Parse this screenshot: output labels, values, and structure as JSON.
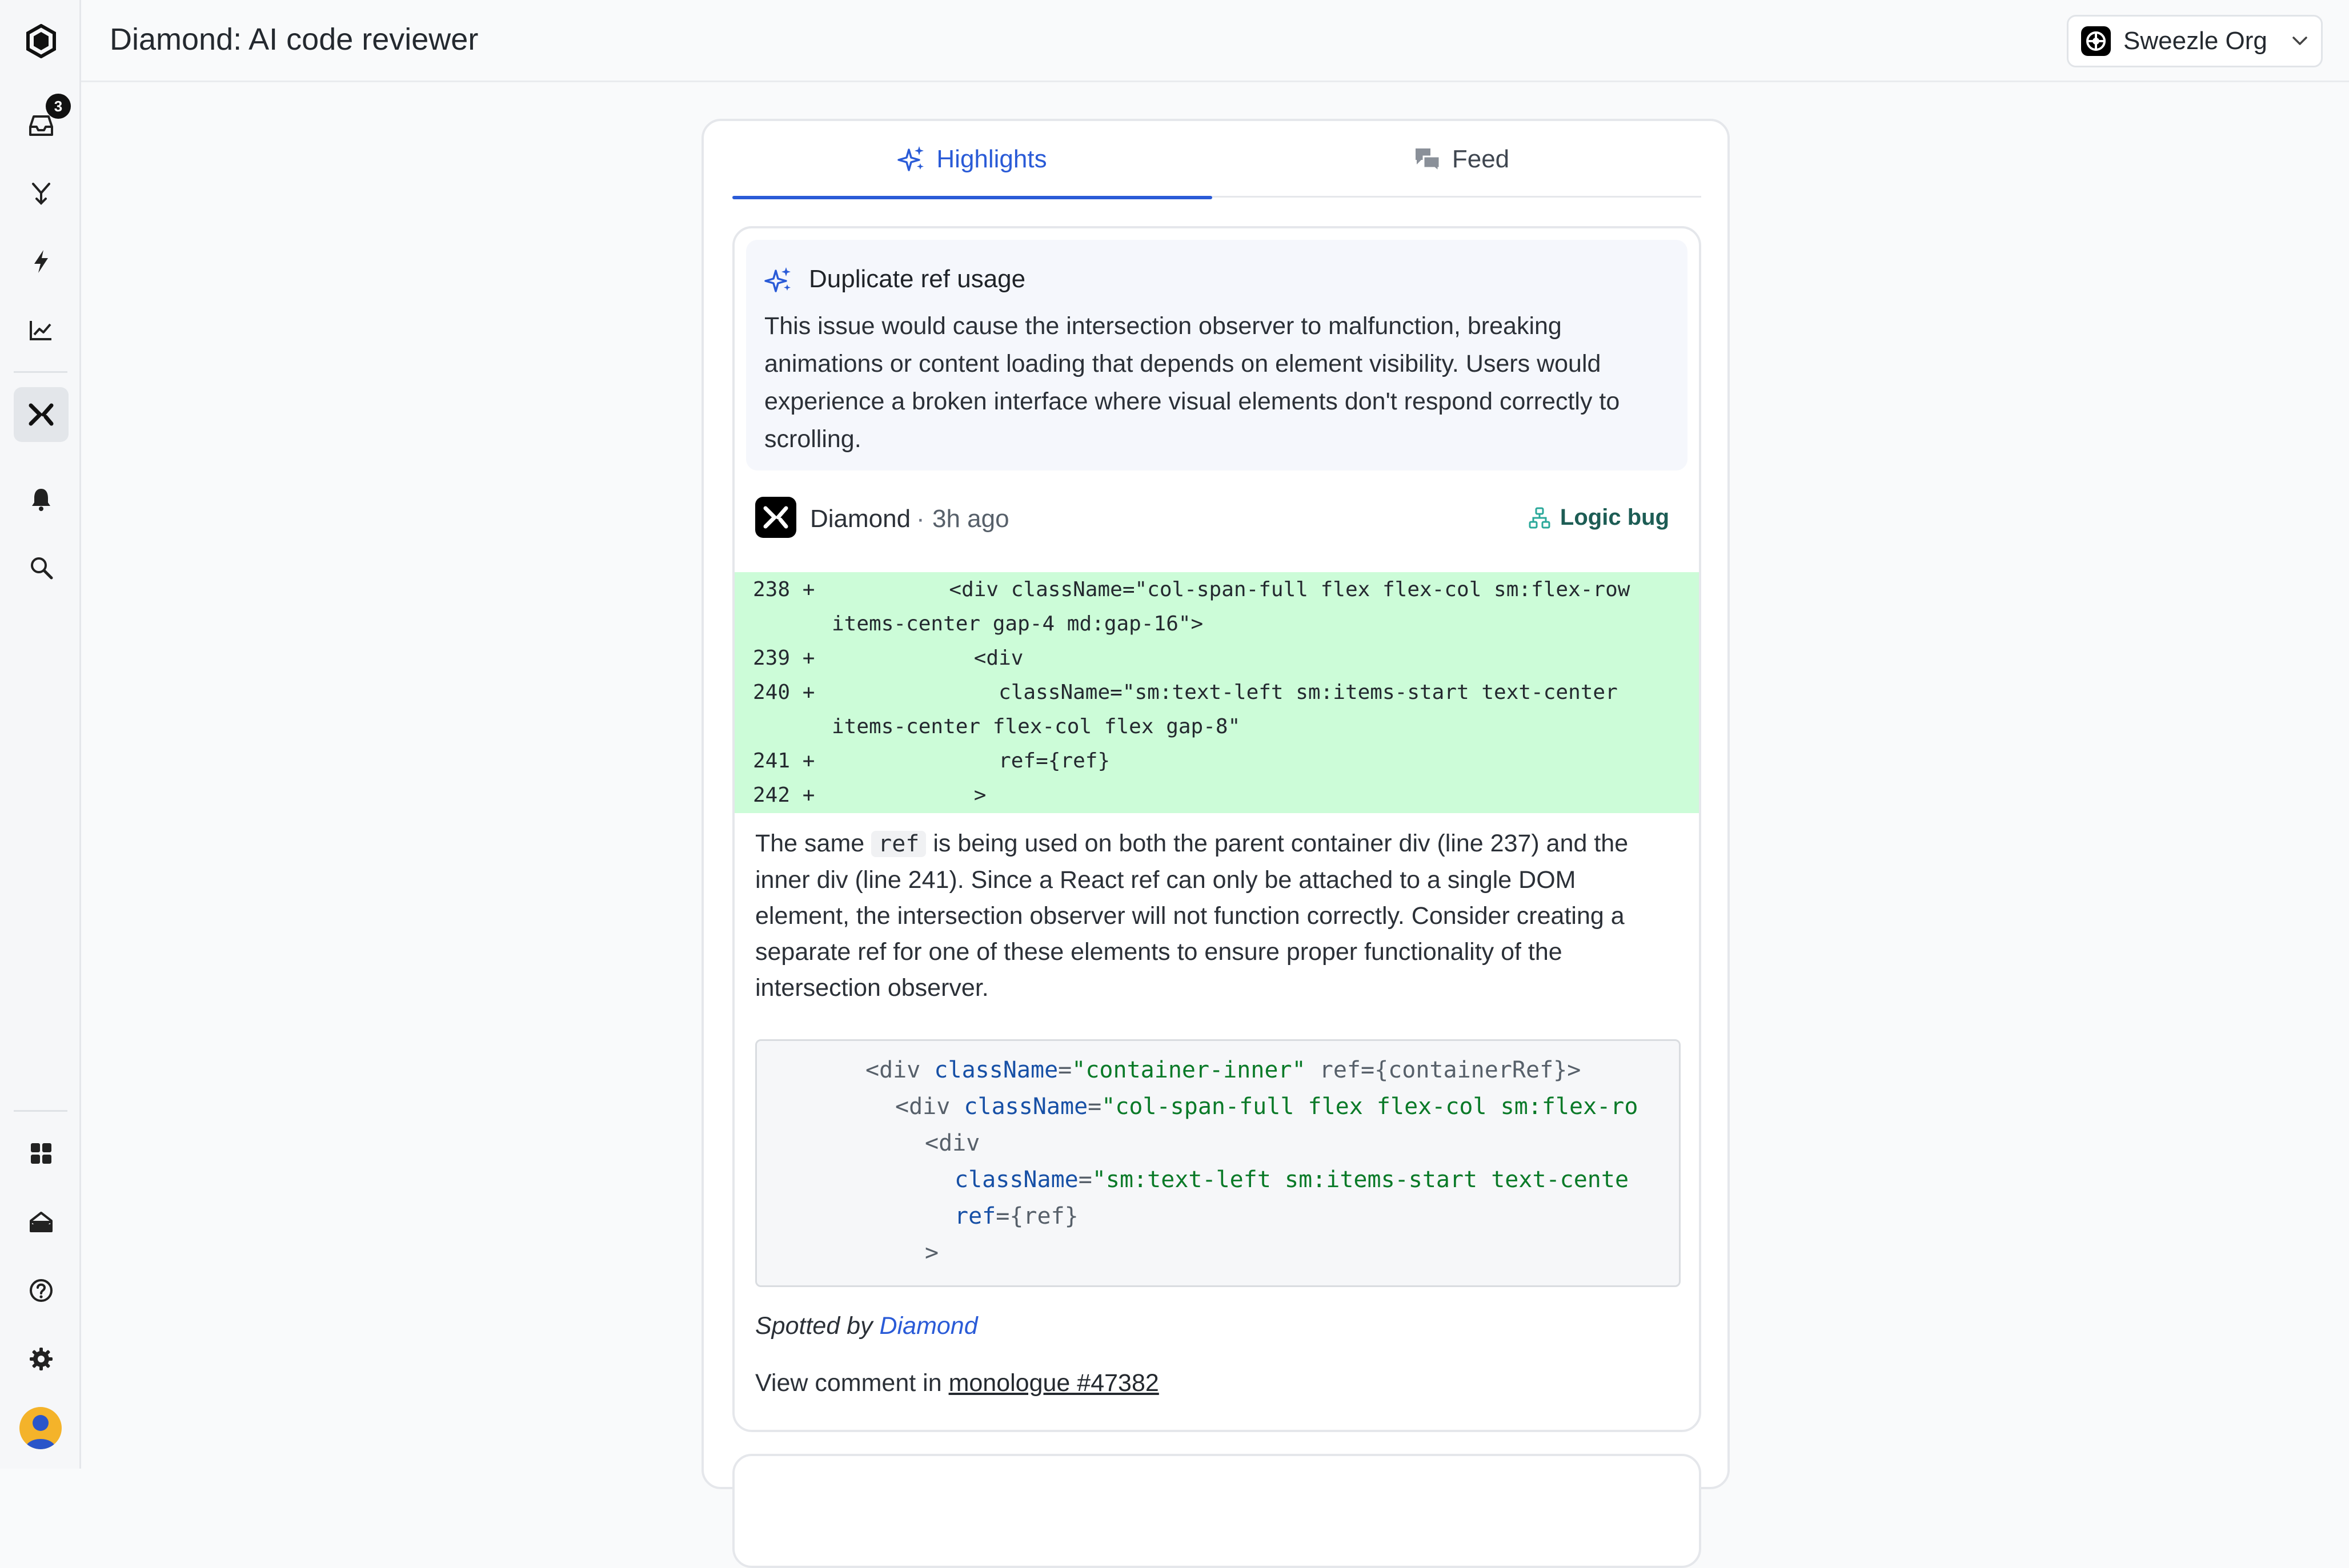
{
  "header": {
    "title": "Diamond: AI code reviewer",
    "org_name": "Sweezle Org"
  },
  "sidebar": {
    "inbox_badge": "3",
    "items": [
      {
        "icon": "hexagon-logo-icon"
      },
      {
        "icon": "inbox-icon"
      },
      {
        "icon": "merge-icon"
      },
      {
        "icon": "lightning-icon"
      },
      {
        "icon": "chart-line-icon"
      },
      {
        "icon": "diamond-icon",
        "active": true
      },
      {
        "icon": "bell-icon"
      },
      {
        "icon": "search-icon"
      },
      {
        "icon": "grid-icon"
      },
      {
        "icon": "mail-open-icon"
      },
      {
        "icon": "help-icon"
      },
      {
        "icon": "gear-icon"
      },
      {
        "icon": "avatar"
      }
    ]
  },
  "tabs": [
    {
      "label": "Highlights",
      "active": true,
      "icon": "sparkles-icon"
    },
    {
      "label": "Feed",
      "active": false,
      "icon": "chat-bubbles-icon"
    }
  ],
  "highlight": {
    "title": "Duplicate ref usage",
    "summary": "This issue would cause the intersection observer to malfunction, breaking animations or content loading that depends on element visibility. Users would experience a broken interface where visual elements don't respond correctly to scrolling.",
    "author": "Diamond",
    "separator": "·",
    "time": "3h ago",
    "tag": "Logic bug",
    "diff_lines": [
      {
        "num": "238",
        "sign": "+",
        "code": "        <div className=\"col-span-full flex flex-col sm:flex-row"
      },
      {
        "num": "",
        "sign": "",
        "code": "items-center gap-4 md:gap-16\">"
      },
      {
        "num": "239",
        "sign": "+",
        "code": "          <div"
      },
      {
        "num": "240",
        "sign": "+",
        "code": "            className=\"sm:text-left sm:items-start text-center"
      },
      {
        "num": "",
        "sign": "",
        "code": "items-center flex-col flex gap-8\""
      },
      {
        "num": "241",
        "sign": "+",
        "code": "            ref={ref}"
      },
      {
        "num": "242",
        "sign": "+",
        "code": "          >"
      }
    ],
    "explanation_before": "The same ",
    "explanation_code": "ref",
    "explanation_after": " is being used on both the parent container div (line 237) and the inner div (line 241). Since a React ref can only be attached to a single DOM element, the intersection observer will not function correctly. Consider creating a separate ref for one of these elements to ensure proper functionality of the intersection observer.",
    "suggestion": {
      "line1_tag": "<div ",
      "line1_attr": "className",
      "line1_eq": "=",
      "line1_str": "\"container-inner\"",
      "line1_rest": " ref={containerRef}>",
      "line2_tag": "<div ",
      "line2_attr": "className",
      "line2_eq": "=",
      "line2_str": "\"col-span-full flex flex-col sm:flex-ro",
      "line3": "<div",
      "line4_attr": "className",
      "line4_eq": "=",
      "line4_str": "\"sm:text-left sm:items-start text-cente",
      "line5_attr": "ref",
      "line5_rest": "={ref}",
      "line6": ">"
    },
    "spotted_prefix": "Spotted by ",
    "spotted_by": "Diamond",
    "view_prefix": "View comment in ",
    "view_link": "monologue #47382"
  }
}
